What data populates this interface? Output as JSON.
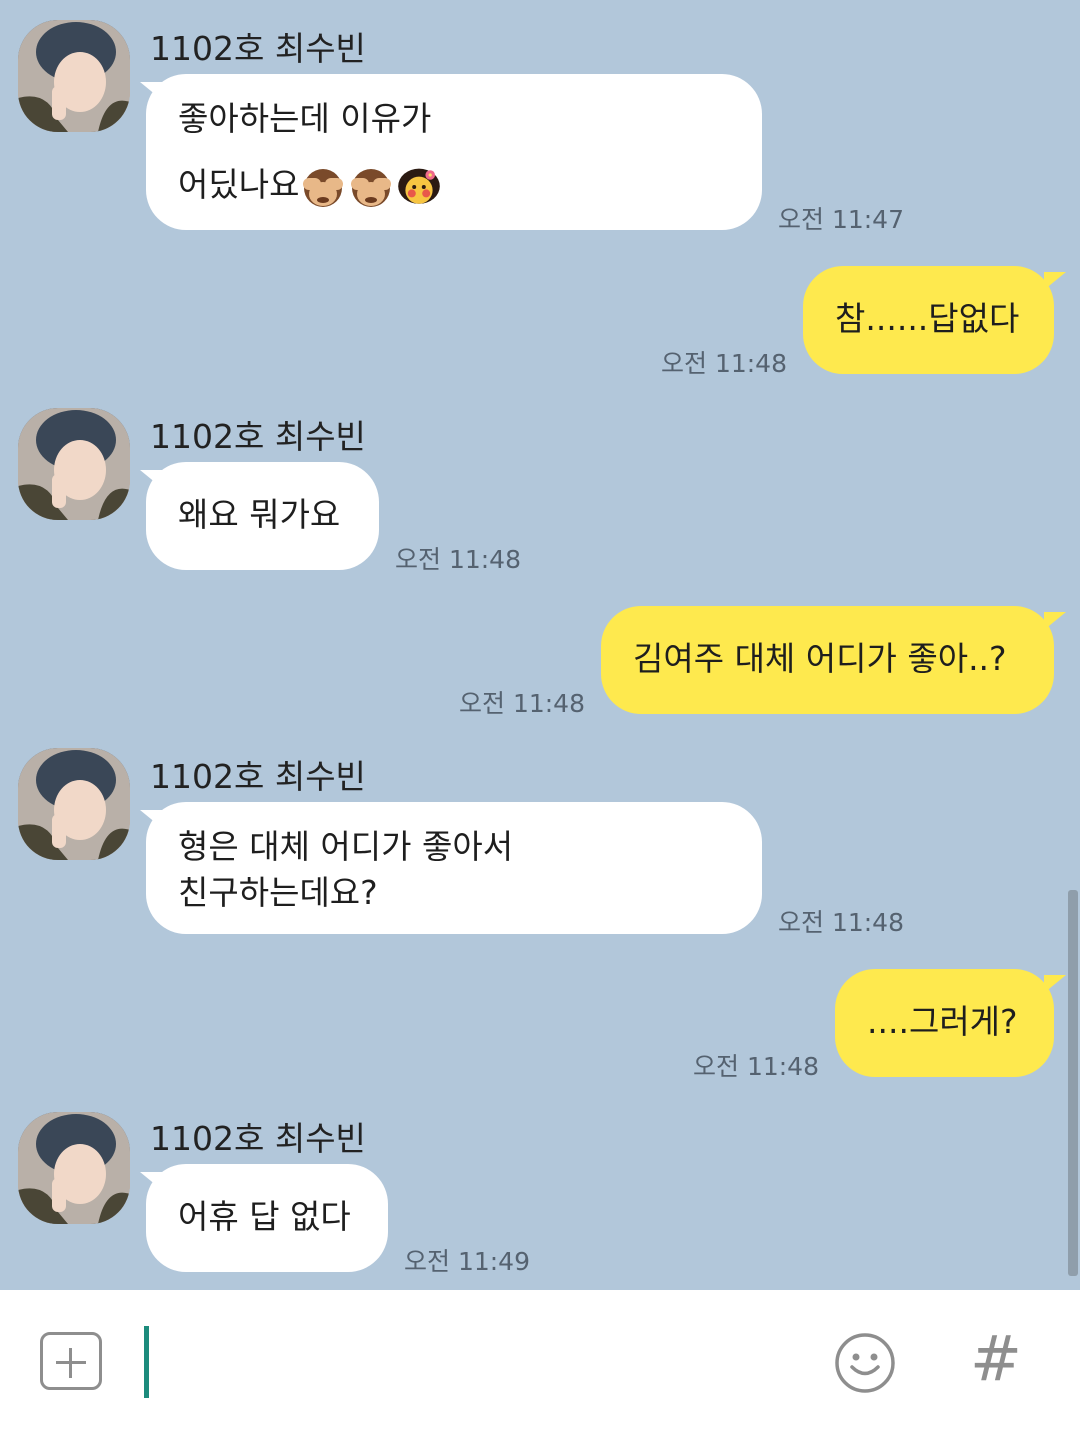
{
  "chat": {
    "messages": [
      {
        "sender": "1102호 최수빈",
        "lines": [
          "좋아하는데 이유가",
          "어딨나요"
        ],
        "emoji": [
          "see-no-evil-monkey",
          "see-no-evil-monkey",
          "blushing-girl"
        ],
        "time": "오전 11:47"
      },
      {
        "text": "참......답없다",
        "time": "오전 11:48"
      },
      {
        "sender": "1102호 최수빈",
        "text": "왜요 뭐가요",
        "time": "오전 11:48"
      },
      {
        "text": "김여주 대체 어디가 좋아..?",
        "time": "오전 11:48"
      },
      {
        "sender": "1102호 최수빈",
        "lines": [
          "형은 대체 어디가 좋아서",
          "친구하는데요?"
        ],
        "time": "오전 11:48"
      },
      {
        "text": "....그러게?",
        "time": "오전 11:48"
      },
      {
        "sender": "1102호 최수빈",
        "text": "어휴 답 없다",
        "time": "오전 11:49"
      }
    ]
  },
  "input_bar": {
    "plus_icon": "plus-square-icon",
    "emoji_icon": "smiley-icon",
    "hash_label": "#",
    "message_value": ""
  },
  "colors": {
    "background": "#b2c7da",
    "my_bubble": "#fee94e",
    "their_bubble": "#ffffff",
    "cursor": "#1c8b7c"
  }
}
